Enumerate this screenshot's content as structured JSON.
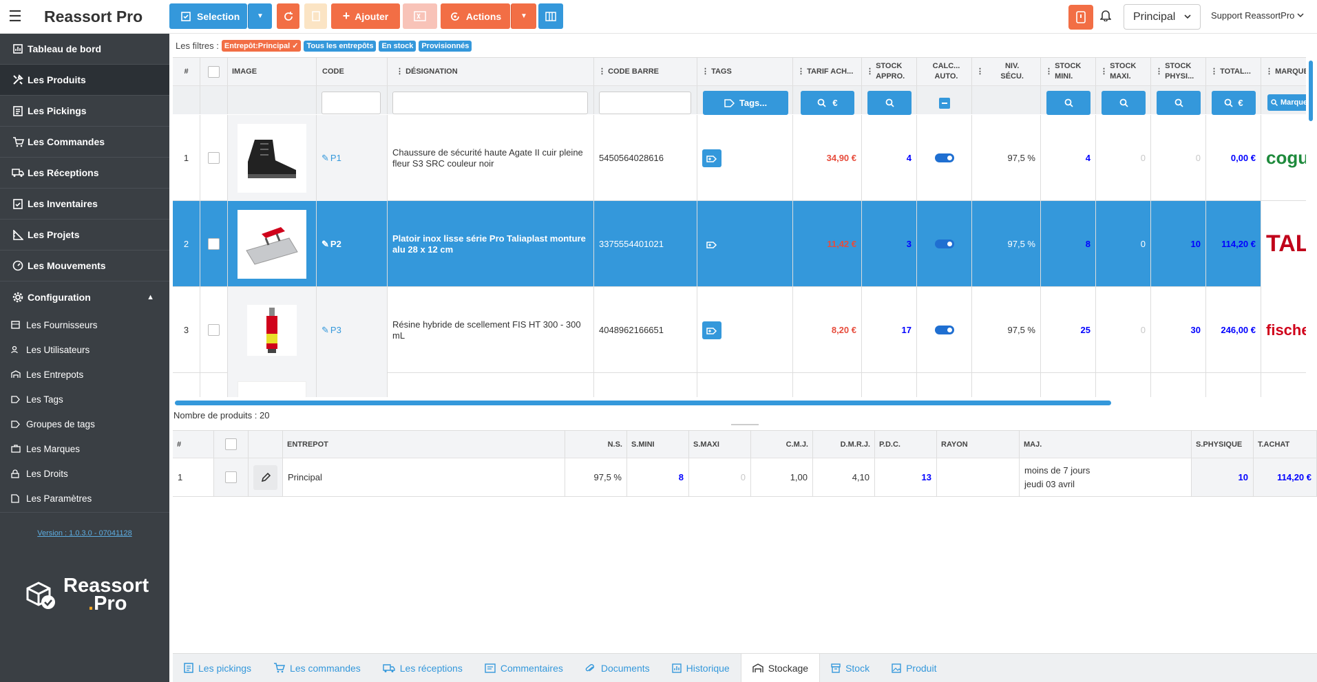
{
  "app": {
    "title": "Reassort Pro"
  },
  "sidebar": {
    "items": [
      {
        "label": "Tableau de bord",
        "icon": "chart-icon"
      },
      {
        "label": "Les Produits",
        "icon": "tools-icon"
      },
      {
        "label": "Les Pickings",
        "icon": "receipt-icon"
      },
      {
        "label": "Les Commandes",
        "icon": "cart-icon"
      },
      {
        "label": "Les Réceptions",
        "icon": "truck-icon"
      },
      {
        "label": "Les Inventaires",
        "icon": "clipboard-icon"
      },
      {
        "label": "Les Projets",
        "icon": "ruler-icon"
      },
      {
        "label": "Les Mouvements",
        "icon": "gauge-icon"
      },
      {
        "label": "Configuration",
        "icon": "gear-icon"
      }
    ],
    "subitems": [
      {
        "label": "Les Fournisseurs"
      },
      {
        "label": "Les Utilisateurs"
      },
      {
        "label": "Les Entrepots"
      },
      {
        "label": "Les Tags"
      },
      {
        "label": "Groupes de tags"
      },
      {
        "label": "Les Marques"
      },
      {
        "label": "Les Droits"
      },
      {
        "label": "Les Paramètres"
      }
    ],
    "version": "Version : 1.0.3.0 - 07041128",
    "logo_line1": "Reassort",
    "logo_line2": "Pro"
  },
  "toolbar": {
    "selection_label": "Selection",
    "add_label": "Ajouter",
    "actions_label": "Actions",
    "warehouse": "Principal",
    "user": "Support ReassortPro"
  },
  "filters": {
    "label": "Les filtres :",
    "chips": [
      "Entrepôt:Principal",
      "Tous les entrepôts",
      "En stock",
      "Provisionnés"
    ]
  },
  "grid": {
    "headers": {
      "num": "#",
      "image": "IMAGE",
      "code": "CODE",
      "designation": "DÉSIGNATION",
      "barcode": "CODE BARRE",
      "tags": "TAGS",
      "tarif": "TARIF ACH...",
      "stock_appro_1": "STOCK",
      "stock_appro_2": "APPRO.",
      "calc_1": "CALC...",
      "calc_2": "AUTO.",
      "niv_1": "NIV.",
      "niv_2": "SÉCU.",
      "mini_1": "STOCK",
      "mini_2": "MINI.",
      "maxi_1": "STOCK",
      "maxi_2": "MAXI.",
      "phys_1": "STOCK",
      "phys_2": "PHYSI...",
      "total": "TOTAL...",
      "marque": "MARQUE"
    },
    "filter_buttons": {
      "tags": "Tags...",
      "euro": "€",
      "marque": "Marque"
    },
    "rows": [
      {
        "n": "1",
        "code": "P1",
        "designation": "Chaussure de sécurité haute Agate II cuir pleine fleur S3 SRC couleur noir",
        "barcode": "5450564028616",
        "tarif": "34,90 €",
        "appro": "4",
        "niv": "97,5 %",
        "mini": "4",
        "maxi": "0",
        "phys": "0",
        "total": "0,00 €",
        "brand": "coguar"
      },
      {
        "n": "2",
        "code": "P2",
        "designation": "Platoir inox lisse série Pro Taliaplast monture alu 28 x 12 cm",
        "barcode": "3375554401021",
        "tarif": "11,42 €",
        "appro": "3",
        "niv": "97,5 %",
        "mini": "8",
        "maxi": "0",
        "phys": "10",
        "total": "114,20 €",
        "brand": "TAL"
      },
      {
        "n": "3",
        "code": "P3",
        "designation": "Résine hybride de scellement FIS HT 300 - 300 mL",
        "barcode": "4048962166651",
        "tarif": "8,20 €",
        "appro": "17",
        "niv": "97,5 %",
        "mini": "25",
        "maxi": "0",
        "phys": "30",
        "total": "246,00 €",
        "brand": "fischer"
      }
    ],
    "count": "Nombre de produits : 20"
  },
  "lower": {
    "headers": {
      "num": "#",
      "entrepot": "ENTREPOT",
      "ns": "N.S.",
      "smini": "S.MINI",
      "smaxi": "S.MAXI",
      "cmj": "C.M.J.",
      "dmrj": "D.M.R.J.",
      "pdc": "P.D.C.",
      "rayon": "RAYON",
      "maj": "MAJ.",
      "sphys": "S.PHYSIQUE",
      "tachat": "T.ACHAT"
    },
    "row": {
      "n": "1",
      "entrepot": "Principal",
      "ns": "97,5 %",
      "smini": "8",
      "smaxi": "0",
      "cmj": "1,00",
      "dmrj": "4,10",
      "pdc": "13",
      "rayon": "",
      "maj1": "moins de 7 jours",
      "maj2": "jeudi 03 avril",
      "sphys": "10",
      "tachat": "114,20 €"
    }
  },
  "tabs": [
    "Les pickings",
    "Les commandes",
    "Les réceptions",
    "Commentaires",
    "Documents",
    "Historique",
    "Stockage",
    "Stock",
    "Produit"
  ],
  "colors": {
    "accent": "#3498db",
    "orange": "#f26e45",
    "sidebar": "#3a3f44"
  }
}
